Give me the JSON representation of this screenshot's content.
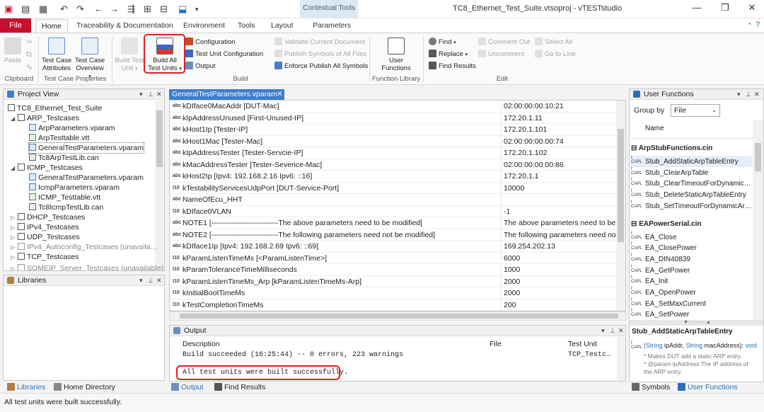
{
  "title_bar": {
    "title": "TC8_Ethernet_Test_Suite.vtsoproj - vTESTstudio",
    "contextual_group": "Contextual Tools",
    "win_minimize": "—",
    "win_restore": "❐",
    "win_close": "✕"
  },
  "ribbon_tabs": {
    "file": "File",
    "home": "Home",
    "traceability": "Traceability & Documentation",
    "environment": "Environment",
    "tools": "Tools",
    "layout": "Layout",
    "parameters": "Parameters"
  },
  "ribbon": {
    "clipboard": {
      "paste": "Paste",
      "group": "Clipboard"
    },
    "tcp": {
      "attributes_l1": "Test Case",
      "attributes_l2": "Attributes",
      "overview_l1": "Test Case",
      "overview_l2": "Overview",
      "group": "Test Case Properties"
    },
    "build": {
      "build_test_unit_l1": "Build Test",
      "build_test_unit_l2": "Unit",
      "build_all_l1": "Build All",
      "build_all_l2": "Test Units",
      "configuration": "Configuration",
      "test_unit_configuration": "Test Unit Configuration",
      "output": "Output",
      "validate": "Validate Current Document",
      "publish_symbols": "Publish Symbols of All Files",
      "enforce_publish": "Enforce Publish All Symbols",
      "group": "Build"
    },
    "function_library": {
      "user_functions_l1": "User",
      "user_functions_l2": "Functions",
      "group": "Function Library"
    },
    "edit": {
      "find": "Find",
      "replace": "Replace",
      "find_results": "Find Results",
      "comment_out": "Comment Out",
      "uncomment": "Uncomment",
      "select_all": "Select All",
      "go_to_line": "Go to Line",
      "group": "Edit"
    }
  },
  "project_view": {
    "title": "Project View",
    "root": "TC8_Ethernet_Test_Suite",
    "items": [
      "ARP_Testcases",
      "ArpParameters.vparam",
      "ArpTesttable.vtt",
      "GeneralTestParameters.vparam",
      "Tc8ArpTestLib.can",
      "ICMP_Testcases",
      "GeneralTestParameters.vparam",
      "IcmpParameters.vparam",
      "ICMP_Testtable.vtt",
      "Tc8IcmpTestLib.can",
      "DHCP_Testcases",
      "IPv4_Testcases",
      "UDP_Testcases",
      "IPv4_Autoconfig_Testcases (unavaila…",
      "TCP_Testcases",
      "SOMEIP_Server_Testcases (unavailable)"
    ]
  },
  "libraries": {
    "title": "Libraries"
  },
  "left_bottom_tabs": {
    "libraries": "Libraries",
    "home_directory": "Home Directory"
  },
  "editor": {
    "tab": "GeneralTestParameters.vparam",
    "rows": [
      {
        "icon": "abc",
        "name": "kDIface0MacAddr [DUT-Mac]",
        "value": "02:00:00:00:10:21"
      },
      {
        "icon": "abc",
        "name": "kIpAddressUnused [First-Unused-IP]",
        "value": "172.20.1.11"
      },
      {
        "icon": "abc",
        "name": "kHost1Ip [Tester-IP]",
        "value": "172.20.1.101"
      },
      {
        "icon": "abc",
        "name": "kHost1Mac [Tester-Mac]",
        "value": "02:00:00:00:00:74"
      },
      {
        "icon": "abc",
        "name": "kIpAddressTester [Tester-Servcie-IP]",
        "value": "172.20.1.102"
      },
      {
        "icon": "abc",
        "name": "kMacAddressTester [Tester-Severice-Mac]",
        "value": "02:00:00:00:00:86"
      },
      {
        "icon": "abc",
        "name": "kHost2Ip [Ipv4: 192.168.2.16 Ipv6: ::16]",
        "value": "172.20.1.1"
      },
      {
        "icon": "I10",
        "name": "kTestabilityServicesUdpPort [DUT-Service-Port]",
        "value": "10000"
      },
      {
        "icon": "abc",
        "name": "NameOfEcu_HHT",
        "value": ""
      },
      {
        "icon": "I10",
        "name": "kDIface0VLAN",
        "value": "-1"
      },
      {
        "icon": "abc",
        "name": "NOTE1 [---------------------------The above parameters need to be modified]",
        "value": "The above parameters need to be m"
      },
      {
        "icon": "abc",
        "name": "NOTE2 [---------------------------The following parameters need not be modified]",
        "value": "The following parameters need not b"
      },
      {
        "icon": "abc",
        "name": "kDIface1Ip [Ipv4: 192.168.2.69 Ipv6: ::69]",
        "value": "169.254.202.13"
      },
      {
        "icon": "I10",
        "name": "kParamListenTimeMs [<ParamListenTime>]",
        "value": "6000"
      },
      {
        "icon": "I10",
        "name": "kParamToleranceTimeMilliseconds",
        "value": "1000"
      },
      {
        "icon": "I10",
        "name": "kParamListenTimeMs_Arp [kParamListenTimeMs-Arp]",
        "value": "2000"
      },
      {
        "icon": "I10",
        "name": "kInitialBootTimeMs",
        "value": "2000"
      },
      {
        "icon": "I10",
        "name": "kTestCompletionTimeMs",
        "value": "200"
      }
    ]
  },
  "output": {
    "title": "Output",
    "col_description": "Description",
    "col_file": "File",
    "col_test_unit": "Test Unit",
    "lines": [
      {
        "text": "Build succeeded (16:25:44) -- 0 errors, 223 warnings",
        "test_unit": "TCP_Testc…"
      },
      {
        "text": "All test units were built successfully.",
        "test_unit": ""
      }
    ]
  },
  "output_tabs": {
    "output": "Output",
    "find_results": "Find Results"
  },
  "user_functions": {
    "title": "User Functions",
    "group_by_label": "Group by",
    "group_by_value": "File",
    "col_name": "Name",
    "sections": [
      {
        "title": "ArpStubFunctions.cin",
        "items": [
          "Stub_AddStaticArpTableEntry",
          "Stub_ClearArpTable",
          "Stub_ClearTimeoutForDynamic…",
          "Stub_DeleteStaticArpTableEntry",
          "Stub_SetTimeoutForDynamicAr…"
        ]
      },
      {
        "title": "EAPowerSerial.cin",
        "items": [
          "EA_Close",
          "EA_ClosePower",
          "EA_DIN40839",
          "EA_GetPower",
          "EA_Init",
          "EA_OpenPower",
          "EA_SetMaxCurrent",
          "EA_SetPower"
        ]
      }
    ],
    "detail_title": "Stub_AddStaticArpTableEntry",
    "detail_sig_prefix": "(String",
    "detail_sig_p1": "ipAddr,",
    "detail_sig_mid": "String",
    "detail_sig_p2": "macAddress):",
    "detail_sig_ret": "void",
    "detail_lines": [
      "* Makes DUT add a static ARP entry.",
      "* @param ipAddress The IP address of",
      "the ARP entry."
    ]
  },
  "right_bottom_tabs": {
    "symbols": "Symbols",
    "user_functions": "User Functions"
  },
  "status": {
    "text": "All test units were built successfully."
  },
  "colors": {
    "accent": "#3e7ccf",
    "file_tab": "#c8102e",
    "highlight": "#e02020",
    "contextual": "#dde8f5"
  }
}
